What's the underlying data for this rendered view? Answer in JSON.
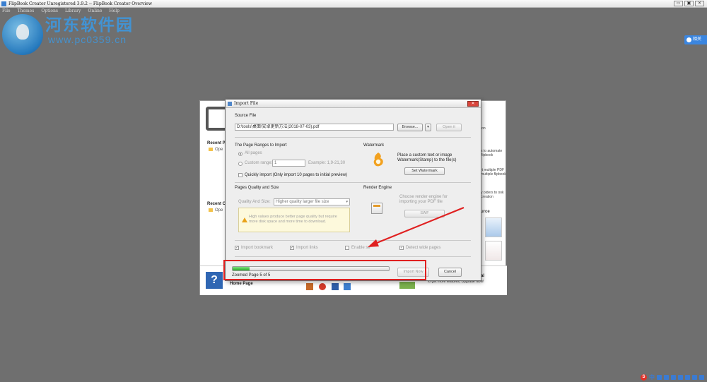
{
  "window": {
    "title": "FlipBook Creator Unregistered 3.9.2  -- FlipBook Creator Overview",
    "controls": [
      "▭",
      "▣",
      "✕"
    ]
  },
  "menu": [
    "File",
    "Themes",
    "Options",
    "Library",
    "Online",
    "Help"
  ],
  "watermark": {
    "site_cn": "河东软件园",
    "url": "www.pc0359.cn"
  },
  "side_widget": {
    "label": "相关"
  },
  "overview": {
    "recent_projects": "Recent P",
    "recent_open_1": "Ope",
    "recent_online": "Recent O",
    "recent_open_2": "Ope",
    "right_texts": {
      "title": "ion",
      "t1": "s to automate flipbook",
      "t2": "rt multiple PDF multiple flipbook",
      "t3": "y olders to ook creation",
      "source": "urce"
    },
    "help_icon": "?",
    "home_page": "Home Page",
    "upgrade_title": "al",
    "upgrade_text": "to get more features, Upgrade Now!"
  },
  "dialog": {
    "title": "Import File",
    "close": "✕",
    "source_file": {
      "label": "Source File",
      "path": "D:\\tools\\桌面\\安卓更新方法(2018-07-03).pdf",
      "browse": "Browse...",
      "drop": "▾",
      "open_it": "Open it"
    },
    "page_ranges": {
      "label": "The Page Ranges to Import",
      "all_pages": "All pages",
      "custom_range": "Custom range:",
      "custom_value": "1",
      "example": "Example: 1,9-21,30",
      "quickly_import": "Quickly import (Only import 10 pages to  initial  preview)"
    },
    "watermark": {
      "label": "Watermark",
      "desc_line1": "Place a custom text or image",
      "desc_line2": "Watermark(Stamp) to the file(s)",
      "set_button": "Set Watermark"
    },
    "quality": {
      "label": "Pages Quality and Size",
      "field_label": "Quality And Size:",
      "value": "Higher quality larger file size",
      "warning_line1": "High values produce better page quality but require",
      "warning_line2": "more disk space and more time to download."
    },
    "render_engine": {
      "label": "Render Engine",
      "desc_line1": "Choose render engine for",
      "desc_line2": "importing your PDF file",
      "swf_button": "SWF"
    },
    "options": {
      "import_bookmark": "Import bookmark",
      "import_links": "Import links",
      "enable_search": "Enable se",
      "detect_wide_pages": "Detect wide pages"
    },
    "progress": {
      "percent": 11,
      "status": "Zoomed Page 5 of 5"
    },
    "import_now": "Import Now",
    "cancel": "Cancel"
  },
  "annotation_color": "#e02020",
  "tray": {
    "s_logo": "S",
    "ime": "中"
  }
}
